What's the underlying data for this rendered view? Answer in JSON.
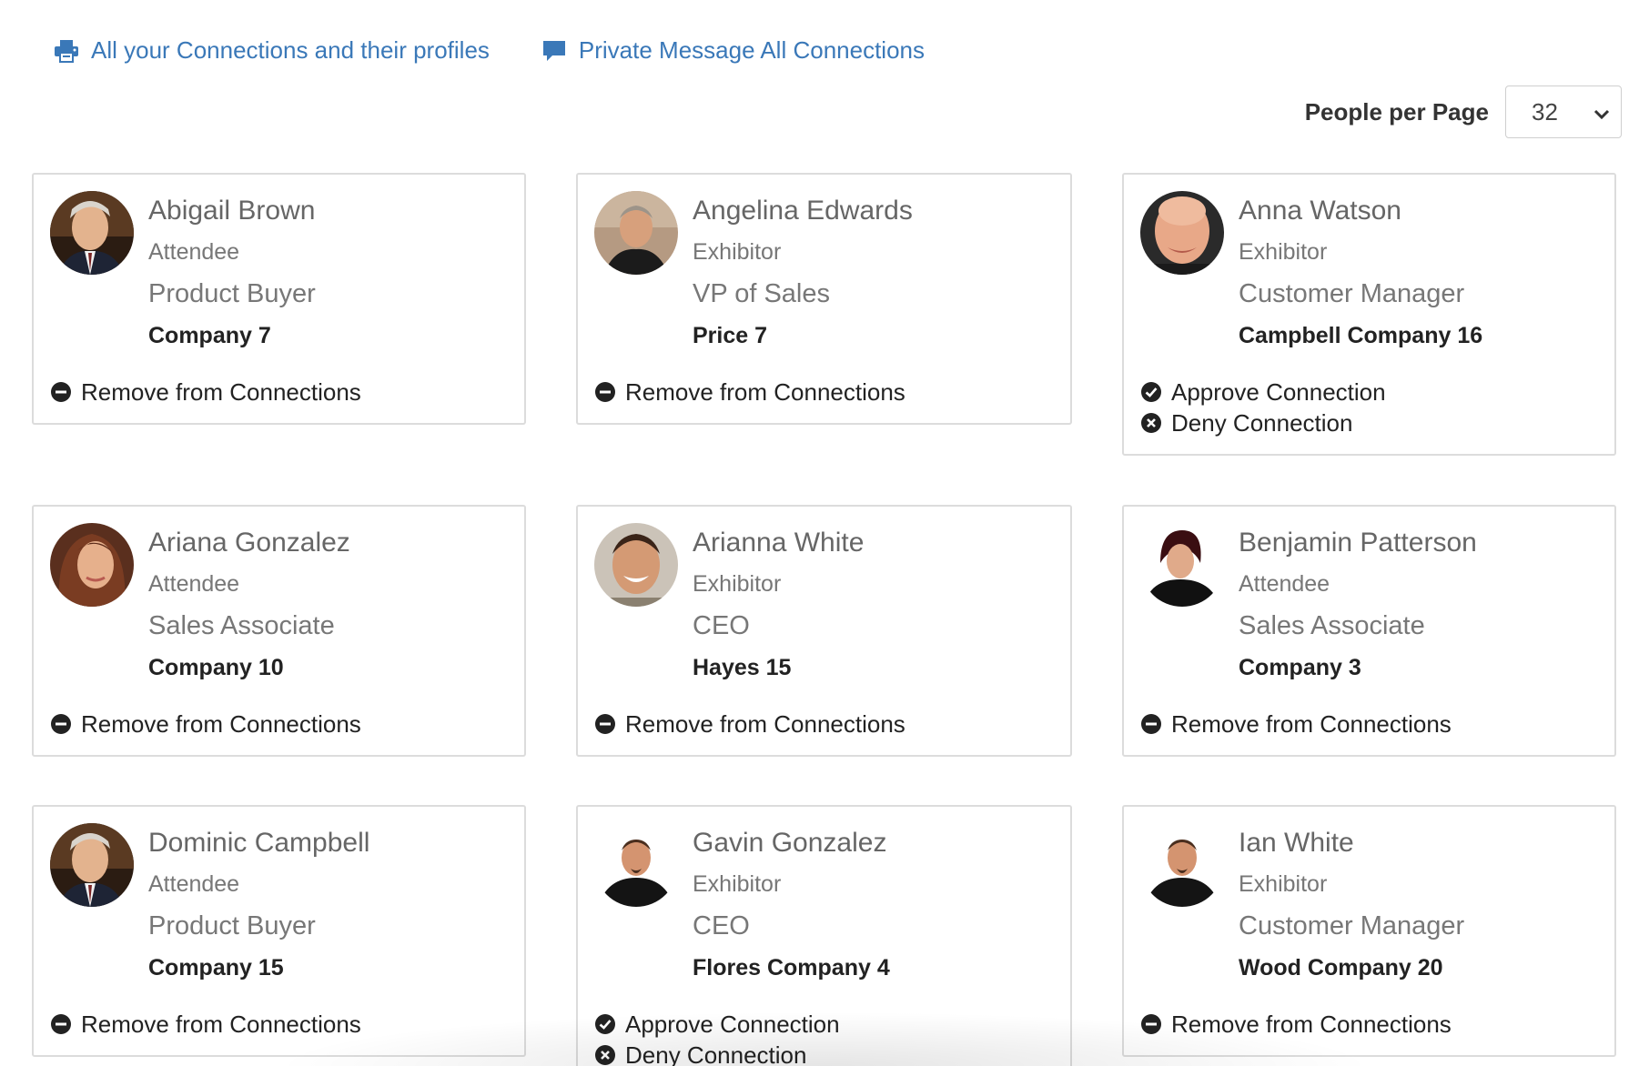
{
  "toolbar": {
    "print_label": "All your Connections and their profiles",
    "message_label": "Private Message All Connections",
    "print_icon": "printer-icon",
    "message_icon": "chat-bubble-icon"
  },
  "pagination": {
    "label": "People per Page",
    "value": "32"
  },
  "colors": {
    "link": "#3a78b8",
    "border": "#dcdcdc"
  },
  "connections": [
    {
      "name": "Abigail Brown",
      "type": "Attendee",
      "title": "Product Buyer",
      "company": "Company 7",
      "avatar": "avatar-man-suit",
      "actions": [
        "Remove from Connections"
      ]
    },
    {
      "name": "Angelina Edwards",
      "type": "Exhibitor",
      "title": "VP of Sales",
      "company": "Price 7",
      "avatar": "avatar-older-man",
      "actions": [
        "Remove from Connections"
      ]
    },
    {
      "name": "Anna Watson",
      "type": "Exhibitor",
      "title": "Customer Manager",
      "company": "Campbell Company 16",
      "avatar": "avatar-bald-man",
      "actions": [
        "Approve Connection",
        "Deny Connection"
      ]
    },
    {
      "name": "Ariana Gonzalez",
      "type": "Attendee",
      "title": "Sales Associate",
      "company": "Company 10",
      "avatar": "avatar-woman",
      "actions": [
        "Remove from Connections"
      ]
    },
    {
      "name": "Arianna White",
      "type": "Exhibitor",
      "title": "CEO",
      "company": "Hayes 15",
      "avatar": "avatar-smiling-man",
      "actions": [
        "Remove from Connections"
      ]
    },
    {
      "name": "Benjamin Patterson",
      "type": "Attendee",
      "title": "Sales Associate",
      "company": "Company 3",
      "avatar": "avatar-woman-dark",
      "actions": [
        "Remove from Connections"
      ]
    },
    {
      "name": "Dominic Campbell",
      "type": "Attendee",
      "title": "Product Buyer",
      "company": "Company 15",
      "avatar": "avatar-man-suit",
      "actions": [
        "Remove from Connections"
      ]
    },
    {
      "name": "Gavin Gonzalez",
      "type": "Exhibitor",
      "title": "CEO",
      "company": "Flores Company 4",
      "avatar": "avatar-goatee-man",
      "actions": [
        "Approve Connection",
        "Deny Connection"
      ]
    },
    {
      "name": "Ian White",
      "type": "Exhibitor",
      "title": "Customer Manager",
      "company": "Wood Company 20",
      "avatar": "avatar-goatee-man",
      "actions": [
        "Remove from Connections"
      ]
    }
  ]
}
